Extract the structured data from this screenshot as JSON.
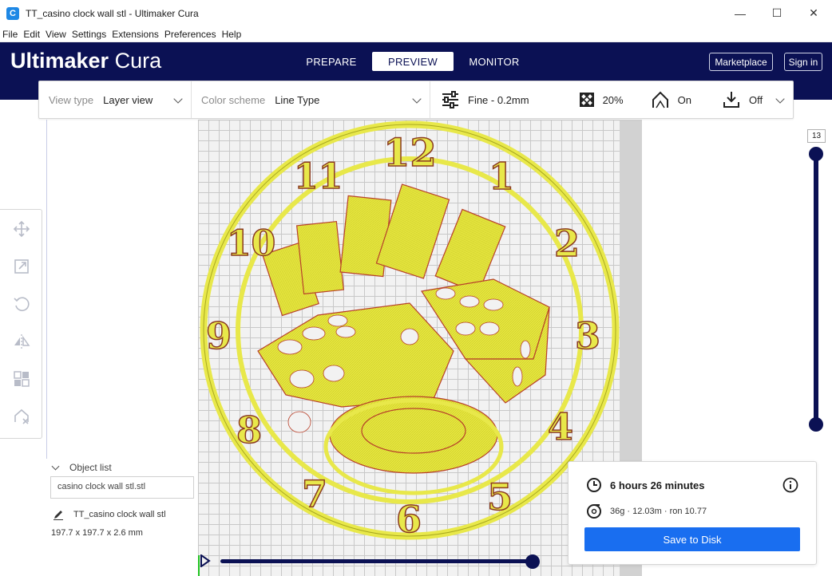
{
  "window": {
    "title": "TT_casino clock wall stl - Ultimaker Cura",
    "app_icon": "C",
    "minimize": "—",
    "maximize": "☐",
    "close": "✕"
  },
  "menu": [
    "File",
    "Edit",
    "View",
    "Settings",
    "Extensions",
    "Preferences",
    "Help"
  ],
  "header": {
    "logo_bold": "Ultimaker",
    "logo_light": "Cura",
    "tabs": [
      "PREPARE",
      "PREVIEW",
      "MONITOR"
    ],
    "active_tab": "PREVIEW",
    "marketplace": "Marketplace",
    "sign_in": "Sign in"
  },
  "toolbar": {
    "view_type_label": "View type",
    "view_type_value": "Layer view",
    "color_scheme_label": "Color scheme",
    "color_scheme_value": "Line Type",
    "profile": "Fine - 0.2mm",
    "infill": "20%",
    "support": "On",
    "adhesion": "Off"
  },
  "object_list": {
    "header": "Object list",
    "field": "casino clock wall stl.stl",
    "object_name": "TT_casino clock wall stl",
    "dimensions": "197.7 x 197.7 x 2.6 mm"
  },
  "layer_slider": {
    "current_layer": "13"
  },
  "print_info": {
    "time": "6 hours 26 minutes",
    "material": "36g · 12.03m · ron 10.77",
    "save_button": "Save to Disk"
  },
  "clock_numbers": [
    "12",
    "1",
    "2",
    "3",
    "4",
    "5",
    "6",
    "7",
    "8",
    "9",
    "10",
    "11"
  ],
  "colors": {
    "header_bg": "#0b1154",
    "accent": "#196ef0",
    "model": "#e8e84a",
    "wall": "#c0392b"
  }
}
